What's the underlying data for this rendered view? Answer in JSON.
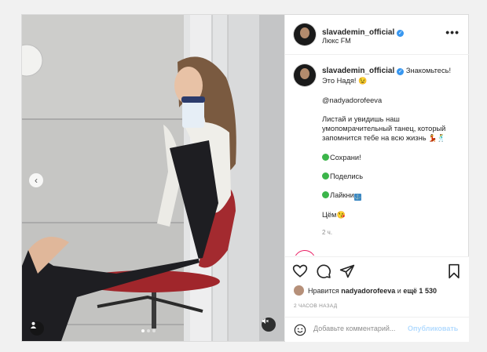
{
  "post": {
    "username": "slavademin_official",
    "location": "Люкс FM",
    "more_label": "•••",
    "caption": {
      "greeting": "Знакомьтесь!",
      "line2": "Это Надя!",
      "mention": "@nadyadorofeeva",
      "body": "Листай и увидишь наш умопомрачительный танец, который запомнится тебе на всю жизнь",
      "save": "Сохрани!",
      "share": "Поделись",
      "like": "Лайкни",
      "kiss": "Цём",
      "time": "2 ч."
    },
    "likes": {
      "prefix": "Нравится",
      "user": "nadyadorofeeva",
      "and_more": "и",
      "count": "ещё 1 530"
    },
    "time_ago": "2 ЧАСОВ НАЗАД",
    "comment": {
      "placeholder": "Добавьте комментарий...",
      "post_label": "Опубликовать"
    }
  },
  "icons": {
    "verified": "verified-badge-icon",
    "more": "more-options-icon",
    "like": "heart-icon",
    "comment": "comment-bubble-icon",
    "share": "paper-plane-icon",
    "save": "bookmark-icon",
    "emoji": "smiley-icon",
    "sound": "sound-muted-icon",
    "tag": "user-tag-icon",
    "prev": "chevron-left-icon"
  },
  "colors": {
    "verified": "#3897f0",
    "post_button_disabled": "#b3dbff",
    "seat": "#a0262b",
    "dress": "#1e1e22"
  },
  "carousel": {
    "slides": 3,
    "active": 1
  }
}
